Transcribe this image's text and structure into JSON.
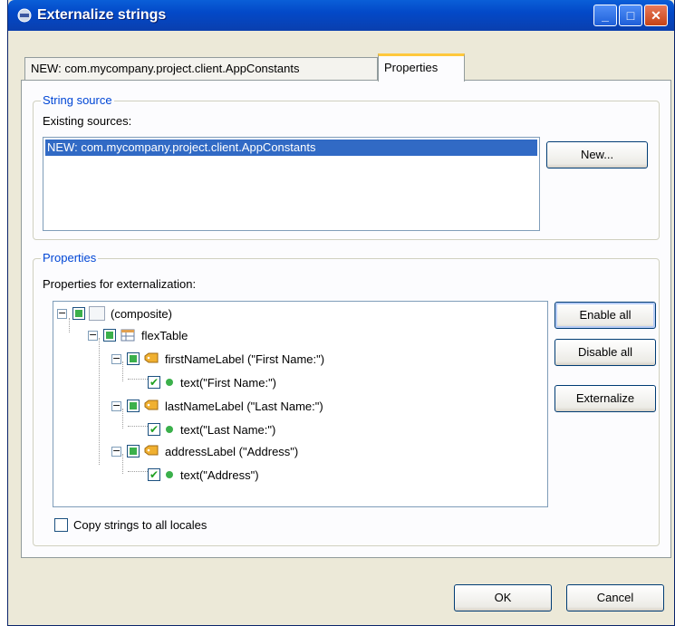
{
  "window": {
    "title": "Externalize strings"
  },
  "tabs": [
    {
      "label": "NEW: com.mycompany.project.client.AppConstants",
      "active": false
    },
    {
      "label": "Properties",
      "active": true
    }
  ],
  "string_source": {
    "legend": "String source",
    "existing_label": "Existing sources:",
    "selected_item": "NEW: com.mycompany.project.client.AppConstants",
    "new_button": "New..."
  },
  "properties": {
    "legend": "Properties",
    "for_label": "Properties for externalization:",
    "tree": [
      {
        "label": "(composite)"
      },
      {
        "label": "flexTable"
      },
      {
        "label": "firstNameLabel (\"First Name:\")"
      },
      {
        "label": "text(\"First Name:\")"
      },
      {
        "label": "lastNameLabel (\"Last Name:\")"
      },
      {
        "label": "text(\"Last Name:\")"
      },
      {
        "label": "addressLabel (\"Address\")"
      },
      {
        "label": "text(\"Address\")"
      }
    ],
    "enable_all": "Enable all",
    "disable_all": "Disable all",
    "externalize": "Externalize",
    "copy_label": "Copy strings to all locales",
    "copy_checked": false
  },
  "footer": {
    "ok": "OK",
    "cancel": "Cancel"
  },
  "colors": {
    "titlebar": "#0349c8",
    "selection": "#316ac5",
    "legend": "#0046d5",
    "check": "#21a121"
  }
}
